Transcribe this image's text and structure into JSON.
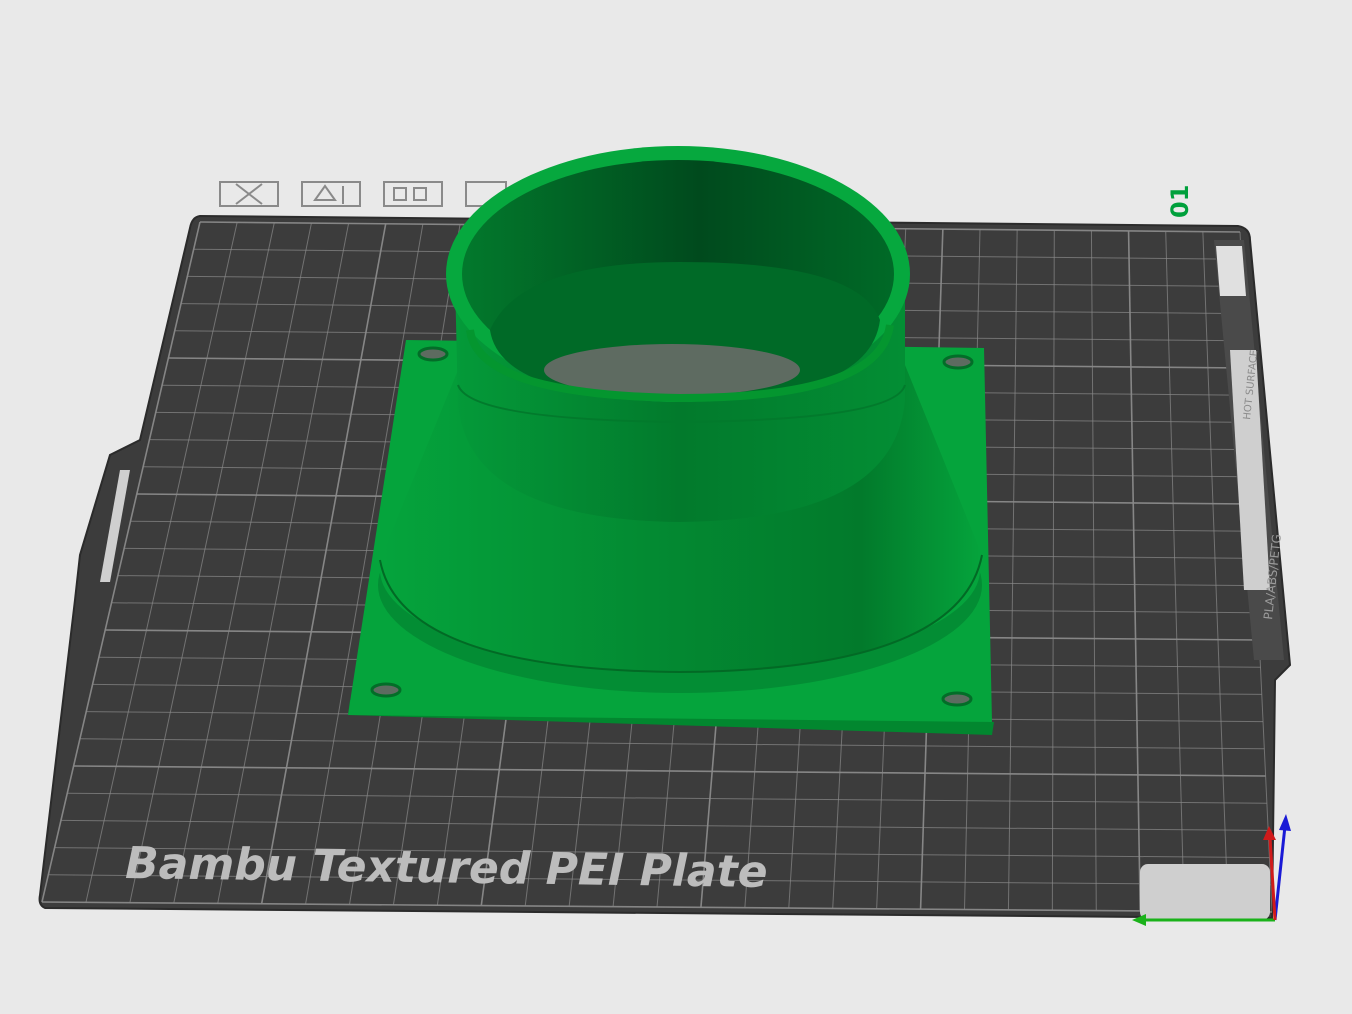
{
  "viewport": {
    "background": "#e9e9e9"
  },
  "plate": {
    "name": "Bambu Textured PEI Plate",
    "number": "01",
    "surface_color": "#3c3c3c",
    "grid_color": "#8a8a8a",
    "side_label_top": "HOT SURFACE",
    "side_label_bottom": "PLA/ABS/PETG",
    "toolbar_icons": [
      "close-plate-icon",
      "auto-orient-icon",
      "arrange-icon",
      "lock-icon"
    ]
  },
  "model": {
    "color": "#00a03c",
    "color_dark": "#006b2a",
    "color_inner": "#004f1f",
    "shape": "fan-duct-adapter"
  },
  "axes": {
    "x_color": "#1ab21a",
    "y_color": "#1a1ad6",
    "z_color": "#d01a1a"
  }
}
